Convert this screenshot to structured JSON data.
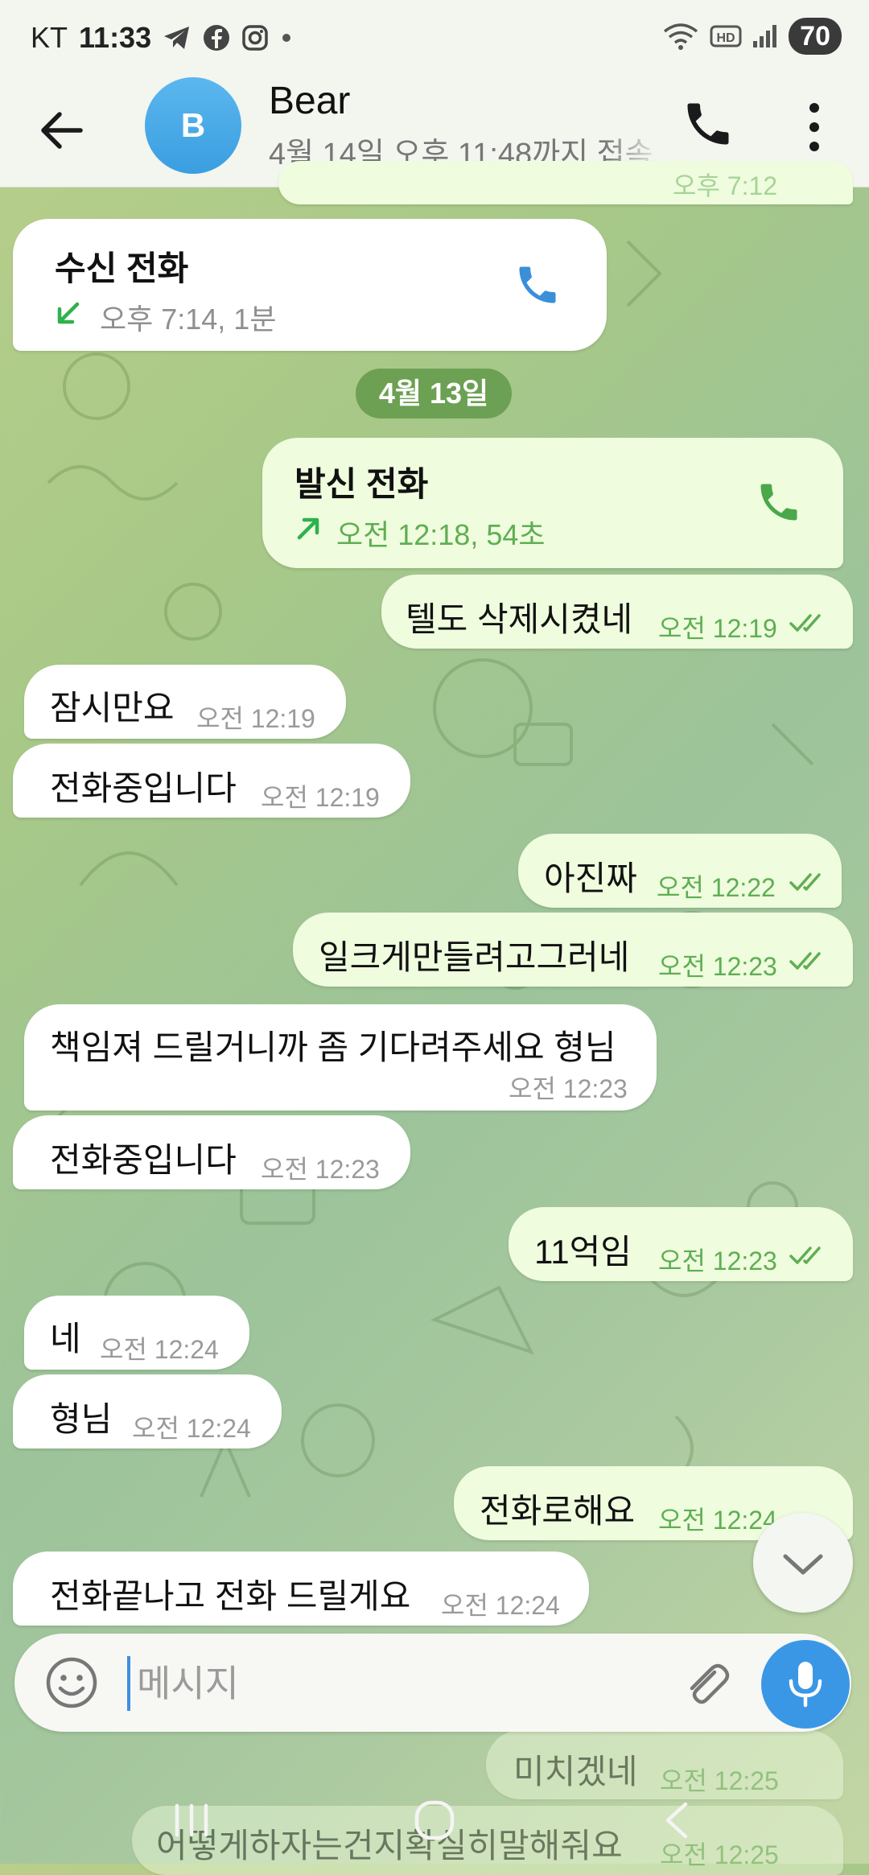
{
  "status_bar": {
    "carrier": "KT",
    "time": "11:33",
    "notification_icons": [
      "telegram-icon",
      "facebook-icon",
      "instagram-icon",
      "dot-icon"
    ],
    "right_icons": [
      "wifi-icon",
      "hd-icon",
      "signal-icon"
    ],
    "battery": "70"
  },
  "header": {
    "avatar_initial": "B",
    "name": "Bear",
    "status": "4월 14일 오후 11:48까지 접속"
  },
  "date_separator": "4월 13일",
  "messages": [
    {
      "dir": "out",
      "text": "",
      "time": "오후 7:12",
      "partial": true
    },
    {
      "dir": "in",
      "type": "call",
      "title": "수신 전화",
      "detail": "오후 7:14, 1분"
    },
    {
      "dir": "out",
      "type": "call",
      "title": "발신 전화",
      "detail": "오전 12:18, 54초"
    },
    {
      "dir": "out",
      "text": "텔도 삭제시켰네",
      "time": "오전 12:19"
    },
    {
      "dir": "in",
      "text": "잠시만요",
      "time": "오전 12:19"
    },
    {
      "dir": "in",
      "text": "전화중입니다",
      "time": "오전 12:19"
    },
    {
      "dir": "out",
      "text": "아진짜",
      "time": "오전 12:22"
    },
    {
      "dir": "out",
      "text": "일크게만들려고그러네",
      "time": "오전 12:23"
    },
    {
      "dir": "in",
      "text": "책임져 드릴거니까 좀 기다려주세요 형님",
      "time": "오전 12:23"
    },
    {
      "dir": "in",
      "text": "전화중입니다",
      "time": "오전 12:23"
    },
    {
      "dir": "out",
      "text": "11억임",
      "time": "오전 12:23"
    },
    {
      "dir": "in",
      "text": "네",
      "time": "오전 12:24"
    },
    {
      "dir": "in",
      "text": "형님",
      "time": "오전 12:24"
    },
    {
      "dir": "out",
      "text": "전화로해요",
      "time": "오전 12:24"
    },
    {
      "dir": "in",
      "text": "전화끝나고 전화 드릴게요",
      "time": "오전 12:24"
    },
    {
      "dir": "out",
      "text": "미치겠네",
      "time": "오전 12:25"
    },
    {
      "dir": "out",
      "text": "어떻게하자는건지확실히말해줘요",
      "time": "오전 12:25"
    }
  ],
  "composer": {
    "placeholder": "메시지"
  },
  "colors": {
    "incoming_bubble": "#ffffff",
    "outgoing_bubble": "#effcde",
    "outgoing_meta": "#5fae53",
    "accent": "#3a97e6",
    "date_pill": "#5e9646"
  }
}
